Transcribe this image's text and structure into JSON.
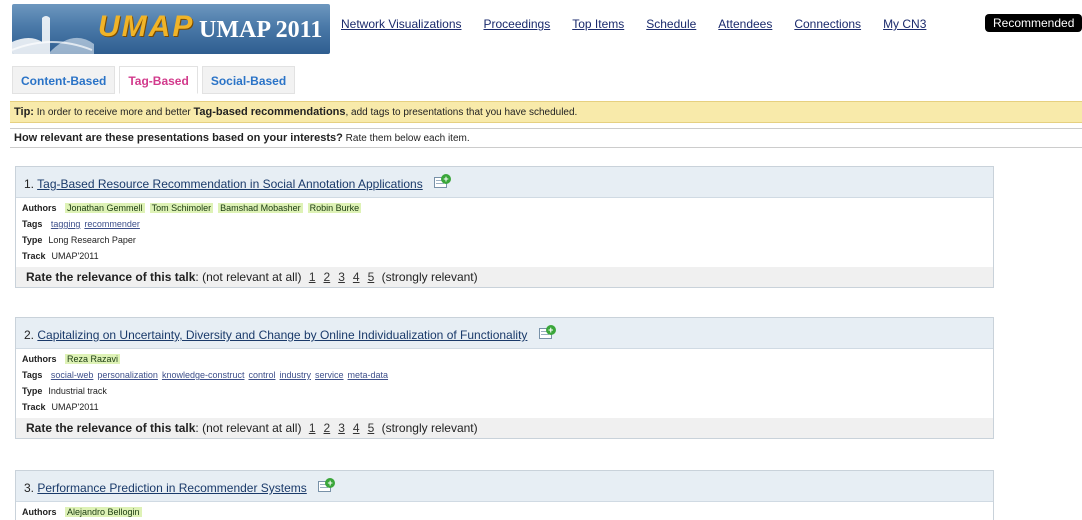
{
  "header": {
    "logo_text": "UMAP",
    "site_title": "UMAP 2011",
    "nav": [
      {
        "label": "Network Visualizations"
      },
      {
        "label": "Proceedings"
      },
      {
        "label": "Top Items"
      },
      {
        "label": "Schedule"
      },
      {
        "label": "Attendees"
      },
      {
        "label": "Connections"
      },
      {
        "label": "My CN3"
      }
    ],
    "active_nav": "Recommended"
  },
  "tabs": [
    {
      "label": "Content-Based",
      "selected": false
    },
    {
      "label": "Tag-Based",
      "selected": true
    },
    {
      "label": "Social-Based",
      "selected": false
    }
  ],
  "tip": {
    "prefix": "Tip:",
    "text1": " In order to receive more and better ",
    "bold": "Tag-based recommendations",
    "text2": ", add tags to presentations that you have scheduled."
  },
  "question": {
    "bold": "How relevant are these presentations based on your interests?",
    "text": " Rate them below each item."
  },
  "labels": {
    "authors": "Authors",
    "tags": "Tags",
    "type": "Type",
    "track": "Track",
    "rate_prefix": "Rate the relevance of this talk",
    "rate_low": ": (not relevant at all)",
    "rate_high": "(strongly relevant)",
    "rate_options": [
      "1",
      "2",
      "3",
      "4",
      "5"
    ]
  },
  "items": [
    {
      "number": "1.",
      "title": "Tag-Based Resource Recommendation in Social Annotation Applications",
      "authors": [
        "Jonathan Gemmell",
        "Tom Schimoler",
        "Bamshad Mobasher",
        "Robin Burke"
      ],
      "tags": [
        "tagging",
        "recommender"
      ],
      "type": "Long Research Paper",
      "track": "UMAP'2011"
    },
    {
      "number": "2.",
      "title": "Capitalizing on Uncertainty, Diversity and Change by Online Individualization of Functionality",
      "authors": [
        "Reza Razavi"
      ],
      "tags": [
        "social-web",
        "personalization",
        "knowledge-construct",
        "control",
        "industry",
        "service",
        "meta-data"
      ],
      "type": "Industrial track",
      "track": "UMAP'2011"
    },
    {
      "number": "3.",
      "title": "Performance Prediction in Recommender Systems",
      "authors": [
        "Alejandro Bellogin"
      ],
      "tags": [],
      "type": "",
      "track": ""
    }
  ]
}
